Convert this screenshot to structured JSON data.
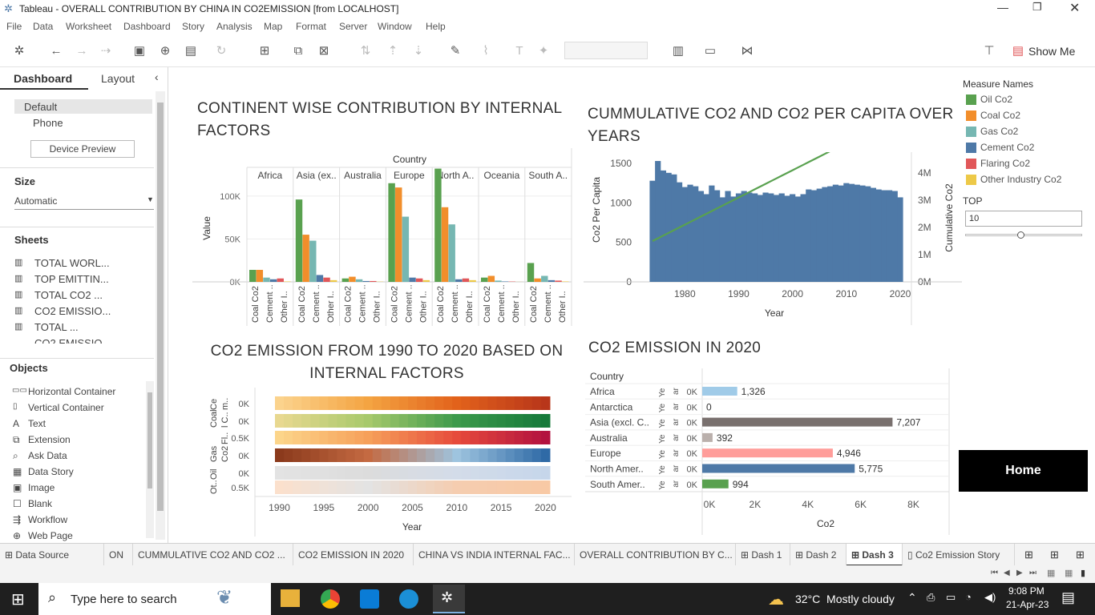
{
  "window": {
    "title": "Tableau - OVERALL CONTRIBUTION BY CHINA IN CO2EMISSION [from LOCALHOST]"
  },
  "menu": [
    "File",
    "Data",
    "Worksheet",
    "Dashboard",
    "Story",
    "Analysis",
    "Map",
    "Format",
    "Server",
    "Window",
    "Help"
  ],
  "toolbar": {
    "show_me": "Show Me"
  },
  "sidebar": {
    "tabs": [
      "Dashboard",
      "Layout"
    ],
    "devices": [
      "Default",
      "Phone"
    ],
    "device_preview": "Device Preview",
    "size_title": "Size",
    "size_value": "Automatic",
    "sheets_title": "Sheets",
    "sheets": [
      "TOTAL WORL...",
      "TOP EMITTIN...",
      "TOTAL CO2 ...",
      "CO2 EMISSIO...",
      "TOTAL ...",
      "CO2 EMISSIO..."
    ],
    "objects_title": "Objects",
    "objects": [
      "Horizontal Container",
      "Vertical Container",
      "Text",
      "Extension",
      "Ask Data",
      "Data Story",
      "Image",
      "Blank",
      "Workflow",
      "Web Page"
    ]
  },
  "chart1": {
    "title": "CONTINENT WISE CONTRIBUTION BY INTERNAL FACTORS",
    "col_header": "Country",
    "ylabel": "Value"
  },
  "chart2": {
    "title": "CUMMULATIVE CO2 AND CO2 PER CAPITA OVER YEARS",
    "ylabel_left": "Co2 Per Capita",
    "ylabel_right": "Cumulative Co2",
    "xlabel": "Year"
  },
  "chart3": {
    "title": "CO2 EMISSION FROM 1990 TO 2020 BASED ON INTERNAL FACTORS",
    "xlabel": "Year"
  },
  "chart4": {
    "title": "CO2 EMISSION IN 2020",
    "row_header": "Country",
    "xlabel": "Co2"
  },
  "legend": {
    "title": "Measure Names",
    "items": [
      {
        "name": "Oil Co2",
        "color": "#59a14f"
      },
      {
        "name": "Coal Co2",
        "color": "#f28e2b"
      },
      {
        "name": "Gas Co2",
        "color": "#76b7b2"
      },
      {
        "name": "Cement Co2",
        "color": "#4e79a7"
      },
      {
        "name": "Flaring Co2",
        "color": "#e15759"
      },
      {
        "name": "Other Industry Co2",
        "color": "#edc948"
      }
    ]
  },
  "top_filter": {
    "label": "TOP",
    "value": "10"
  },
  "home_button": "Home",
  "tabs": [
    "Data Source",
    "ON",
    "CUMMULATIVE CO2 AND CO2 ...",
    "CO2 EMISSION IN 2020",
    "CHINA VS INDIA INTERNAL FAC...",
    "OVERALL CONTRIBUTION BY C...",
    "Dash 1",
    "Dash 2",
    "Dash 3",
    "Co2 Emission Story"
  ],
  "taskbar": {
    "search_placeholder": "Type here to search",
    "weather": "32°C  Mostly cloudy",
    "time": "9:08 PM",
    "date": "21-Apr-23"
  },
  "chart_data": [
    {
      "type": "bar",
      "title": "CONTINENT WISE CONTRIBUTION BY INTERNAL FACTORS",
      "ylabel": "Value",
      "column_header": "Country",
      "panels": [
        "Africa",
        "Asia (ex..",
        "Australia",
        "Europe",
        "North A..",
        "Oceania",
        "South A.."
      ],
      "ticks": [
        "Coal Co2",
        "Cement ..",
        "Other I.."
      ],
      "yticks": [
        "0K",
        "50K",
        "100K"
      ],
      "ylim": [
        0,
        140000
      ],
      "series": [
        {
          "name": "Oil Co2",
          "values": [
            14000,
            96000,
            4000,
            115000,
            132000,
            5000,
            22000
          ]
        },
        {
          "name": "Coal Co2",
          "values": [
            14000,
            55000,
            6000,
            110000,
            87000,
            7000,
            4000
          ]
        },
        {
          "name": "Gas Co2",
          "values": [
            5000,
            48000,
            3000,
            76000,
            67000,
            1500,
            7000
          ]
        },
        {
          "name": "Cement Co2",
          "values": [
            3000,
            8000,
            1000,
            5000,
            3000,
            500,
            2000
          ]
        },
        {
          "name": "Flaring Co2",
          "values": [
            4000,
            5000,
            1000,
            4000,
            4000,
            400,
            1500
          ]
        },
        {
          "name": "Other Industry Co2",
          "values": [
            500,
            2000,
            300,
            2000,
            2000,
            100,
            500
          ]
        }
      ]
    },
    {
      "type": "bar",
      "title": "CUMMULATIVE CO2 AND CO2 PER CAPITA OVER YEARS",
      "xlabel": "Year",
      "ylabel": "Co2 Per Capita",
      "y2label": "Cumulative Co2",
      "xticks": [
        "1980",
        "1990",
        "2000",
        "2010",
        "2020"
      ],
      "yticks": [
        "0",
        "500",
        "1000",
        "1500"
      ],
      "y2ticks": [
        "0M",
        "1M",
        "2M",
        "3M",
        "4M"
      ],
      "x": [
        1974,
        1975,
        1976,
        1977,
        1978,
        1979,
        1980,
        1981,
        1982,
        1983,
        1984,
        1985,
        1986,
        1987,
        1988,
        1989,
        1990,
        1991,
        1992,
        1993,
        1994,
        1995,
        1996,
        1997,
        1998,
        1999,
        2000,
        2001,
        2002,
        2003,
        2004,
        2005,
        2006,
        2007,
        2008,
        2009,
        2010,
        2011,
        2012,
        2013,
        2014,
        2015,
        2016,
        2017,
        2018,
        2019,
        2020
      ],
      "bar_values": [
        1280,
        1530,
        1410,
        1380,
        1360,
        1260,
        1200,
        1230,
        1210,
        1150,
        1110,
        1220,
        1160,
        1070,
        1150,
        1080,
        1120,
        1150,
        1130,
        1120,
        1100,
        1130,
        1120,
        1100,
        1120,
        1090,
        1110,
        1080,
        1110,
        1170,
        1160,
        1180,
        1200,
        1210,
        1230,
        1220,
        1250,
        1240,
        1230,
        1220,
        1210,
        1190,
        1170,
        1160,
        1160,
        1150,
        1070
      ],
      "line_values": [
        1500000,
        1600000,
        1700000,
        1800000,
        1900000,
        2000000,
        2100000,
        2200000,
        2300000,
        2400000,
        2500000,
        2600000,
        2700000,
        2800000,
        2900000,
        3000000,
        3100000,
        3200000,
        3300000,
        3400000,
        3500000,
        3600000,
        3700000,
        3800000,
        3900000,
        4000000,
        4100000,
        4200000,
        4300000,
        4400000,
        4500000,
        4600000,
        4700000,
        4800000,
        4900000,
        5000000,
        5100000,
        5200000,
        5300000,
        5400000,
        5500000,
        5600000,
        5700000,
        5800000,
        5900000,
        6000000,
        6100000
      ]
    },
    {
      "type": "heatmap",
      "title": "CO2 EMISSION FROM 1990 TO 2020 BASED ON INTERNAL FACTORS",
      "xlabel": "Year",
      "xticks": [
        "1990",
        "1995",
        "2000",
        "2005",
        "2010",
        "2015",
        "2020"
      ],
      "rows": [
        {
          "label": "Ce",
          "tick": "0K",
          "palette": "orange"
        },
        {
          "label": "Coal",
          "tick": "0K",
          "palette": "green"
        },
        {
          "label": "Fl..",
          "tick": "0.5K",
          "palette": "red"
        },
        {
          "label": "Gas",
          "tick": "0K",
          "palette": "blue"
        },
        {
          "label": "Oil",
          "tick": "0K",
          "palette": "grey"
        },
        {
          "label": "Ot..",
          "tick": "0.5K",
          "palette": "peach"
        }
      ]
    },
    {
      "type": "bar",
      "title": "CO2 EMISSION IN 2020",
      "xlabel": "Co2",
      "categories": [
        "Africa",
        "Antarctica",
        "Asia (excl. C..",
        "Australia",
        "Europe",
        "North Amer..",
        "South Amer.."
      ],
      "values": [
        1326,
        0,
        7207,
        392,
        4946,
        5775,
        994
      ],
      "labels": [
        "1,326",
        "0",
        "7,207",
        "392",
        "4,946",
        "5,775",
        "994"
      ],
      "colors": [
        "#a0cbe8",
        "#a0cbe8",
        "#79706e",
        "#bab0ac",
        "#ff9d9a",
        "#4e79a7",
        "#59a14f"
      ],
      "xticks": [
        "0K",
        "2K",
        "4K",
        "6K",
        "8K"
      ],
      "xlim": [
        0,
        8500
      ]
    }
  ]
}
